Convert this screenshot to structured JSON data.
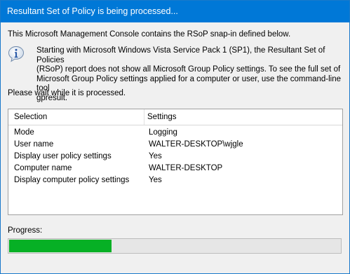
{
  "window": {
    "title": "Resultant Set of Policy is being processed..."
  },
  "intro_text": "This Microsoft Management Console contains the RSoP snap-in defined below.",
  "notice": {
    "icon": "info-icon",
    "lines": [
      "Starting with Microsoft Windows Vista Service Pack 1 (SP1), the Resultant Set of Policies",
      "(RSoP) report does not show all Microsoft Group Policy settings.  To see the full set of",
      "Microsoft Group Policy settings applied for a computer or user, use the command-line tool",
      "gpresult."
    ]
  },
  "wait_text": "Please wait while it is processed.",
  "details": {
    "columns": [
      "Selection",
      "Settings"
    ],
    "rows": [
      {
        "selection": "Mode",
        "setting": "Logging"
      },
      {
        "selection": "User name",
        "setting": "WALTER-DESKTOP\\wjgle"
      },
      {
        "selection": "Display user policy settings",
        "setting": "Yes"
      },
      {
        "selection": "Computer name",
        "setting": "WALTER-DESKTOP"
      },
      {
        "selection": "Display computer policy settings",
        "setting": "Yes"
      }
    ]
  },
  "progress": {
    "label": "Progress:",
    "fraction": 0.31,
    "color": "#06b025"
  },
  "colors": {
    "titlebar": "#0078d7",
    "window_bg": "#f0f0f0"
  }
}
